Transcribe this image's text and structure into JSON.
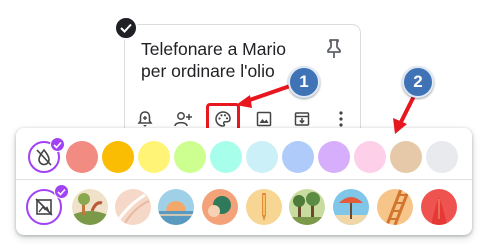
{
  "note": {
    "line1": "Telefonare a Mario",
    "line2": "per ordinare l'olio"
  },
  "toolbar": {
    "items": [
      "reminder-icon",
      "collaborator-icon",
      "palette-icon",
      "image-icon",
      "archive-icon",
      "more-icon"
    ]
  },
  "callouts": {
    "first": "1",
    "second": "2"
  },
  "palette": {
    "colors": [
      "none",
      "#f28b82",
      "#fbbc04",
      "#fff475",
      "#ccff90",
      "#a7ffeb",
      "#cbf0f8",
      "#aecbfa",
      "#d7aefb",
      "#fdcfe8",
      "#e6c9a8",
      "#e8eaed"
    ],
    "selected_color": "none",
    "backgrounds": [
      "none",
      "groceries",
      "food",
      "music",
      "recipes",
      "notes",
      "places",
      "travel",
      "video",
      "celebration",
      "shapes"
    ],
    "selected_background": "none",
    "accent": "#a142f4"
  },
  "annotation": {
    "arrow_color": "#e8161f",
    "callout_color": "#3f73b6"
  }
}
